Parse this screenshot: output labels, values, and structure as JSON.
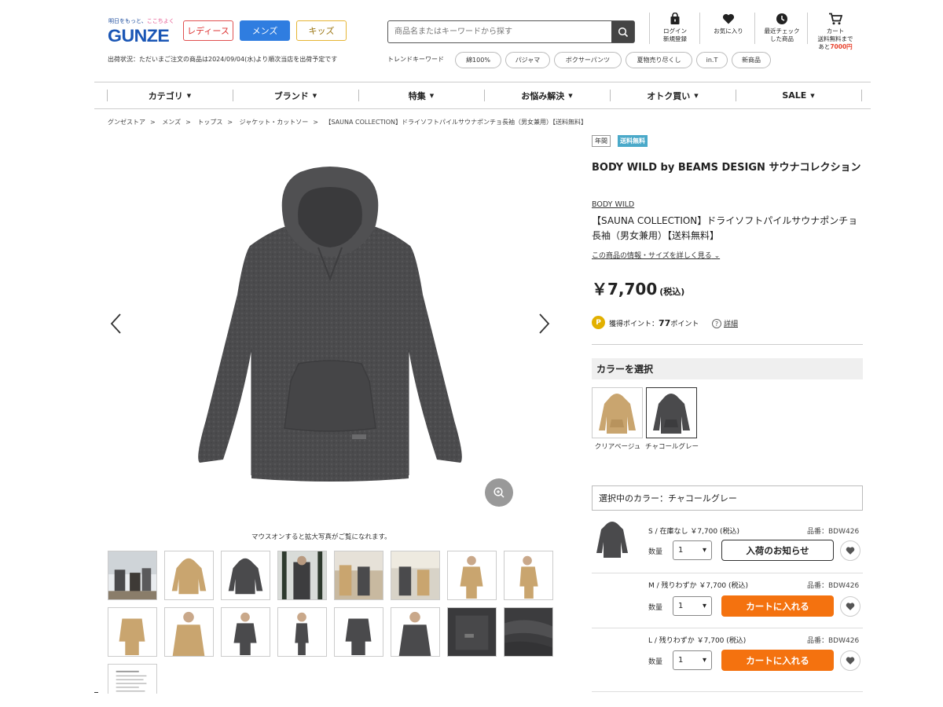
{
  "header": {
    "logo_tagline_a": "明日をもっと、",
    "logo_tagline_b": "ここちよく",
    "logo_text": "GUNZE",
    "gender_tabs": [
      "レディース",
      "メンズ",
      "キッズ"
    ],
    "shipping_status": "出荷状況：ただいまご注文の商品は2024/09/04(水)より順次当店を出荷予定です",
    "search_placeholder": "商品名またはキーワードから探す",
    "trend_label": "トレンドキーワード",
    "trend_keywords": [
      "綿100%",
      "パジャマ",
      "ボクサーパンツ",
      "夏物売り尽くし",
      "in.T",
      "新商品"
    ],
    "icons": [
      {
        "name": "login-icon",
        "label1": "ログイン",
        "label2": "新規登録"
      },
      {
        "name": "heart-icon",
        "label1": "お気に入り",
        "label2": ""
      },
      {
        "name": "clock-icon",
        "label1": "最近チェック",
        "label2": "した商品"
      },
      {
        "name": "cart-icon",
        "label1": "カート",
        "label2": ""
      }
    ],
    "cart_note_a": "送料無料まで",
    "cart_note_b": "あと",
    "cart_note_amount": "7000円"
  },
  "nav": [
    "カテゴリ",
    "ブランド",
    "特集",
    "お悩み解決",
    "オトク買い",
    "SALE"
  ],
  "breadcrumb": [
    "グンゼストア",
    "メンズ",
    "トップス",
    "ジャケット・カットソー",
    "【SAUNA COLLECTION】ドライソフトパイルサウナポンチョ長袖（男女兼用）【送料無料】"
  ],
  "gallery": {
    "hint": "マウスオンすると拡大写真がご覧になれます。"
  },
  "product": {
    "badges": [
      "年間",
      "送料無料"
    ],
    "title": "BODY WILD by BEAMS DESIGN サウナコレクション",
    "brand": "BODY WILD",
    "name": "【SAUNA COLLECTION】ドライソフトパイルサウナポンチョ長袖（男女兼用）【送料無料】",
    "detail_link": "この商品の情報・サイズを詳しく見る",
    "price": "￥7,700",
    "tax": "(税込)",
    "points_label": "獲得ポイント：",
    "points_value": "77",
    "points_unit": "ポイント",
    "points_detail": "詳細",
    "color_header": "カラーを選択",
    "colors": [
      {
        "label": "クリアベージュ",
        "color": "#c9a56f"
      },
      {
        "label": "チャコールグレー",
        "color": "#4a4a4c"
      }
    ],
    "selected_color": "選択中のカラー：チャコールグレー",
    "qty_label": "数量",
    "variants": [
      {
        "line": "S / 在庫なし ￥7,700 (税込)",
        "code": "品番：BDW426",
        "qty": "1",
        "action": "入荷のお知らせ"
      },
      {
        "line": "M / 残りわずか ￥7,700 (税込)",
        "code": "品番：BDW426",
        "qty": "1",
        "action": "カートに入れる"
      },
      {
        "line": "L / 残りわずか ￥7,700 (税込)",
        "code": "品番：BDW426",
        "qty": "1",
        "action": "カートに入れる"
      }
    ]
  },
  "colors": {
    "brand_blue": "#1a56b5",
    "cart_orange": "#f4720f",
    "badge_blue": "#4aa9c9",
    "charcoal": "#4a4a4c",
    "beige": "#c9a56f"
  }
}
